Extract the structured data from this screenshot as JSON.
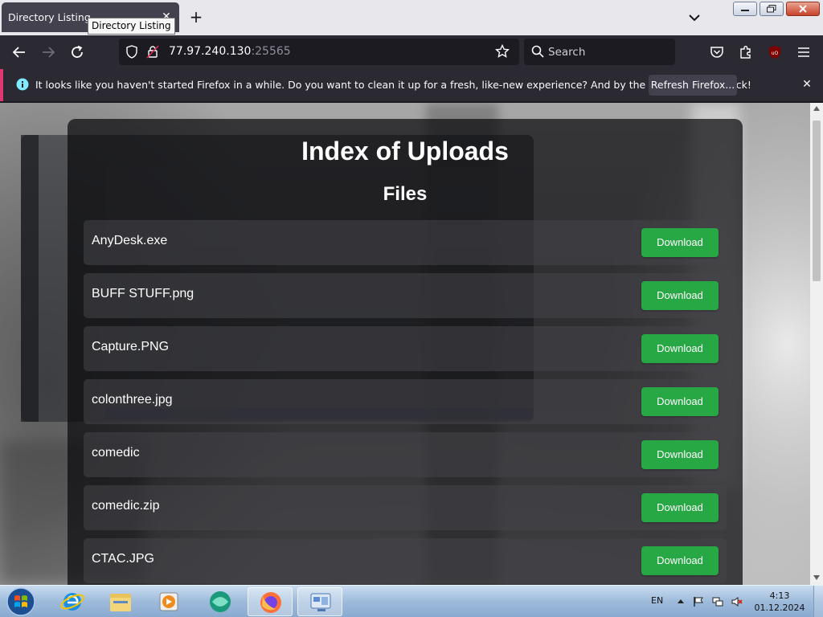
{
  "browser": {
    "tab_title": "Directory Listing",
    "tooltip": "Directory Listing",
    "url_host": "77.97.240.130",
    "url_port": ":25565",
    "search_placeholder": "Search"
  },
  "notification": {
    "message": "It looks like you haven't started Firefox in a while. Do you want to clean it up for a fresh, like-new experience? And by the way, welcome back!",
    "button": "Refresh Firefox..."
  },
  "page": {
    "title": "Index of Uploads",
    "files_heading": "Files",
    "download_label": "Download",
    "files": [
      {
        "name": "AnyDesk.exe"
      },
      {
        "name": "BUFF STUFF.png"
      },
      {
        "name": "Capture.PNG"
      },
      {
        "name": "colonthree.jpg"
      },
      {
        "name": "comedic"
      },
      {
        "name": "comedic.zip"
      },
      {
        "name": "CTAC.JPG"
      }
    ]
  },
  "taskbar": {
    "language": "EN",
    "time": "4:13",
    "date": "01.12.2024"
  },
  "colors": {
    "download_green": "#28a745",
    "notification_accent": "#e23670",
    "toolbar_dark": "#2b2a33"
  }
}
